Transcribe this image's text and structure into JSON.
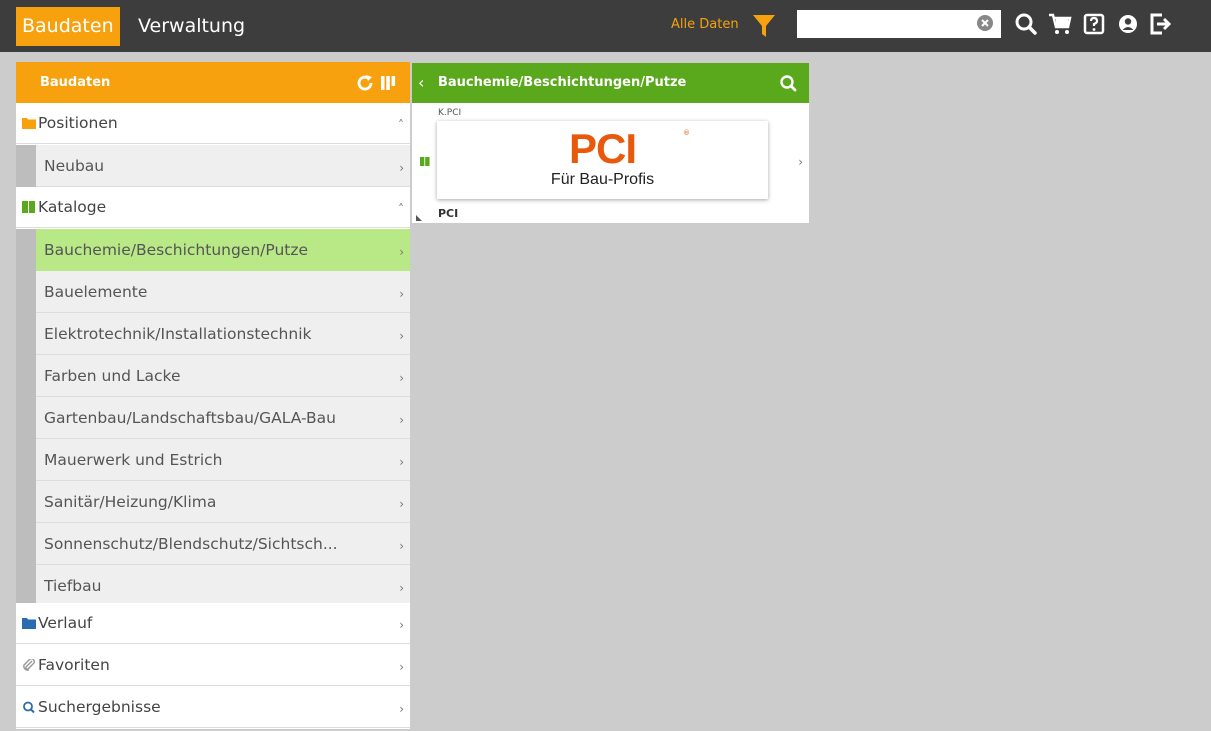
{
  "topbar": {
    "app_tab": "Baudaten",
    "admin_tab": "Verwaltung",
    "filter_label": "Alle Daten",
    "search_value": "",
    "accent": "#f7a10e"
  },
  "left_panel": {
    "title": "Baudaten",
    "sections": {
      "positionen": {
        "label": "Positionen",
        "chevron": "˄"
      },
      "kataloge": {
        "label": "Kataloge",
        "chevron": "˄"
      },
      "verlauf": {
        "label": "Verlauf",
        "chevron": "›"
      },
      "favoriten": {
        "label": "Favoriten",
        "chevron": "›"
      },
      "suchergebnisse": {
        "label": "Suchergebnisse",
        "chevron": "›"
      }
    },
    "positionen_items": [
      {
        "label": "Neubau"
      }
    ],
    "katalog_items": [
      {
        "label": "Bauchemie/Beschichtungen/Putze",
        "active": true
      },
      {
        "label": "Bauelemente"
      },
      {
        "label": "Elektrotechnik/Installationstechnik"
      },
      {
        "label": "Farben und Lacke"
      },
      {
        "label": "Gartenbau/Landschaftsbau/GALA-Bau"
      },
      {
        "label": "Mauerwerk und Estrich"
      },
      {
        "label": "Sanitär/Heizung/Klima"
      },
      {
        "label": "Sonnenschutz/Blendschutz/Sichtsch..."
      },
      {
        "label": "Tiefbau"
      }
    ],
    "chevron": "›"
  },
  "mid_panel": {
    "back": "‹",
    "title": "Bauchemie/Beschichtungen/Putze",
    "card": {
      "code": "K.PCI",
      "logo_text": "PCI",
      "logo_sub": "Für Bau-Profis",
      "reg": "®",
      "name": "PCI",
      "chevron": "›"
    }
  }
}
